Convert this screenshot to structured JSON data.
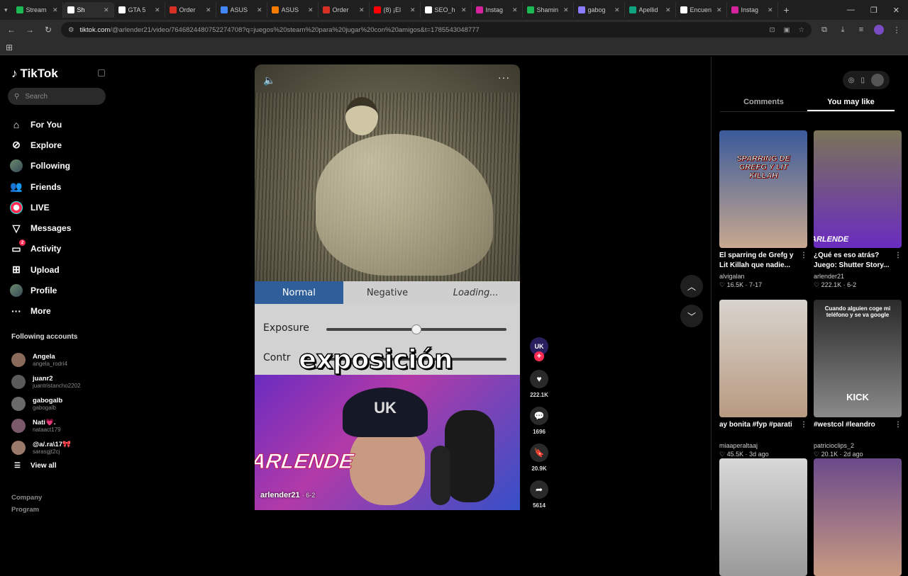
{
  "browser": {
    "tabs": [
      {
        "label": "Stream",
        "color": "#1db954"
      },
      {
        "label": "Sh",
        "color": "#ffffff",
        "active": true
      },
      {
        "label": "GTA 5",
        "color": "#ffffff"
      },
      {
        "label": "Order",
        "color": "#d93025"
      },
      {
        "label": "ASUS",
        "color": "#4285f4"
      },
      {
        "label": "ASUS",
        "color": "#f57c00"
      },
      {
        "label": "Order",
        "color": "#d93025"
      },
      {
        "label": "(8) ¡El",
        "color": "#ff0000"
      },
      {
        "label": "SEO_h",
        "color": "#ffffff"
      },
      {
        "label": "Instag",
        "color": "#d6249f"
      },
      {
        "label": "Shamin",
        "color": "#1db954"
      },
      {
        "label": "gabog",
        "color": "#8a7cff"
      },
      {
        "label": "Apellid",
        "color": "#10a37f"
      },
      {
        "label": "Encuen",
        "color": "#ffffff"
      },
      {
        "label": "Instag",
        "color": "#d6249f"
      }
    ],
    "url_host": "tiktok.com",
    "url_path": "/@arlender21/video/7646824480752274708?q=juegos%20steam%20para%20jugar%20con%20amigos&t=1785543048777"
  },
  "sidebar": {
    "logo": "TikTok",
    "search_placeholder": "Search",
    "nav": [
      {
        "label": "For You",
        "icon": "home-icon",
        "glyph": "⌂"
      },
      {
        "label": "Explore",
        "icon": "compass-icon",
        "glyph": "⊘"
      },
      {
        "label": "Following",
        "icon": "following-avatar-icon",
        "glyph": ""
      },
      {
        "label": "Friends",
        "icon": "friends-icon",
        "glyph": "👥"
      },
      {
        "label": "LIVE",
        "icon": "live-icon",
        "glyph": ""
      },
      {
        "label": "Messages",
        "icon": "send-icon",
        "glyph": "▽"
      },
      {
        "label": "Activity",
        "icon": "activity-icon",
        "glyph": "▭",
        "badge": "2"
      },
      {
        "label": "Upload",
        "icon": "upload-icon",
        "glyph": "⊞"
      },
      {
        "label": "Profile",
        "icon": "profile-avatar-icon",
        "glyph": ""
      },
      {
        "label": "More",
        "icon": "more-icon",
        "glyph": "···"
      }
    ],
    "following_title": "Following accounts",
    "following": [
      {
        "name": "Angela",
        "handle": "angela_rodri4",
        "color": "#8a6a5a"
      },
      {
        "name": "juanr2",
        "handle": "juantristancho2202",
        "color": "#5a5a5a"
      },
      {
        "name": "gabogalb",
        "handle": "gabogalb",
        "color": "#6a6a6a"
      },
      {
        "name": "Nati💗.",
        "handle": "nataact179",
        "color": "#7a5a6a"
      },
      {
        "name": "@a/.ra\\17🎀",
        "handle": "sarasgjt2cj",
        "color": "#9a7a6a"
      }
    ],
    "view_all": "View all",
    "footer": [
      "Company",
      "Program"
    ]
  },
  "video": {
    "segments": [
      "Normal",
      "Negative",
      "Loading..."
    ],
    "slider_labels": [
      "Exposure",
      "Contr"
    ],
    "exposure_value": 0.5,
    "caption": "exposición",
    "streamer_text": "ARLENDE",
    "cap_logo": "UK",
    "author": "arlender21",
    "date": "· 6-2"
  },
  "actions": {
    "avatar_text": "UK",
    "likes": "222.1K",
    "comments": "1696",
    "saves": "20.9K",
    "shares": "5614"
  },
  "right": {
    "tabs": [
      "Comments",
      "You may like"
    ],
    "cards": [
      {
        "title": "El sparring de Grefg y Lit Killah que nadie...",
        "user": "alvigalan",
        "stats": "♡ 16.5K · 7-17",
        "overlay": "SPARRING DE GREFG Y LIT KILLAH",
        "bg1": "#3a5a9a",
        "bg2": "#c8a890"
      },
      {
        "title": "¿Qué es eso atrás? Juego: Shutter Story...",
        "user": "arlender21",
        "stats": "♡ 222.1K · 6-2",
        "overlay": "ARLENDE",
        "bg1": "#7a7458",
        "bg2": "#6a2cc0"
      },
      {
        "title": "ay bonita #fyp #parati",
        "user": "miaaperaltaaj",
        "stats": "♡ 45.5K · 3d ago",
        "overlay": "",
        "bg1": "#d8d4ce",
        "bg2": "#b89a80"
      },
      {
        "title": "#westcol #leandro",
        "user": "patricioclips_2",
        "stats": "♡ 20.1K · 2d ago",
        "overlay": "Cuando alguien coge mi teléfono y se va google",
        "overlay2": "KICK",
        "bg1": "#2a2a2a",
        "bg2": "#8a8a8a"
      },
      {
        "title": "",
        "user": "",
        "stats": "",
        "overlay": "",
        "bg1": "#d8d8d8",
        "bg2": "#9a9a9a"
      },
      {
        "title": "",
        "user": "",
        "stats": "",
        "overlay": "",
        "bg1": "#6a4a8a",
        "bg2": "#c89a82"
      }
    ]
  }
}
